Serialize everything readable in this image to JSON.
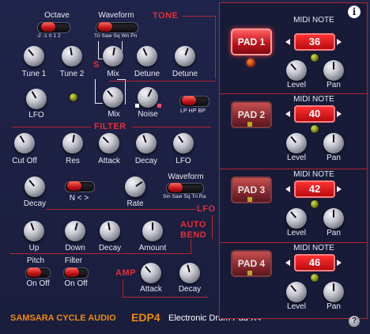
{
  "sections": {
    "tone": "TONE",
    "filter": "FILTER",
    "lfo": "LFO",
    "auto_bend": [
      "AUTO",
      "BEND"
    ],
    "amp": "AMP"
  },
  "tone": {
    "octave_label": "Octave",
    "octave_values": "-2 -1  0  1  2",
    "waveform_label": "Waveform",
    "waveform_values": "Tri Saw Sq Wn Pn",
    "tune1": "Tune 1",
    "tune2": "Tune 2",
    "mix1": "Mix",
    "detune1": "Detune",
    "detune2": "Detune",
    "lfo": "LFO",
    "mix2": "Mix",
    "noise": "Noise",
    "filter_types": "LP HP BP",
    "s_marker": "S"
  },
  "filter": {
    "cutoff": "Cut Off",
    "res": "Res",
    "attack": "Attack",
    "decay": "Decay",
    "lfo": "LFO"
  },
  "lfo": {
    "decay": "Decay",
    "direction": "N < >",
    "rate": "Rate",
    "waveform_label": "Waveform",
    "waveform_values": "Sin Saw Sq Tri Ra"
  },
  "bend": {
    "up": "Up",
    "down": "Down",
    "decay": "Decay",
    "amount": "Amount",
    "pitch_label": "Pitch",
    "filter_label": "Filter",
    "on_off": "On  Off"
  },
  "amp": {
    "attack": "Attack",
    "decay": "Decay"
  },
  "pads": [
    {
      "label": "PAD 1",
      "midi_label": "MIDI NOTE",
      "note": "36",
      "level": "Level",
      "pan": "Pan",
      "active": true
    },
    {
      "label": "PAD 2",
      "midi_label": "MIDI NOTE",
      "note": "40",
      "level": "Level",
      "pan": "Pan",
      "active": false
    },
    {
      "label": "PAD 3",
      "midi_label": "MIDI NOTE",
      "note": "42",
      "level": "Level",
      "pan": "Pan",
      "active": false
    },
    {
      "label": "PAD 4",
      "midi_label": "MIDI NOTE",
      "note": "46",
      "level": "Level",
      "pan": "Pan",
      "active": false
    }
  ],
  "footer": {
    "brand": "SAMSARA CYCLE AUDIO",
    "product": "EDP4",
    "product_name": "Electronic Drum Pad X4"
  },
  "icons": {
    "info": "i",
    "help": "?"
  },
  "colors": {
    "background": "#1c1f3e",
    "section_red": "#e0303a",
    "brand_orange": "#ee8a10",
    "led_green": "#b7c22a"
  }
}
